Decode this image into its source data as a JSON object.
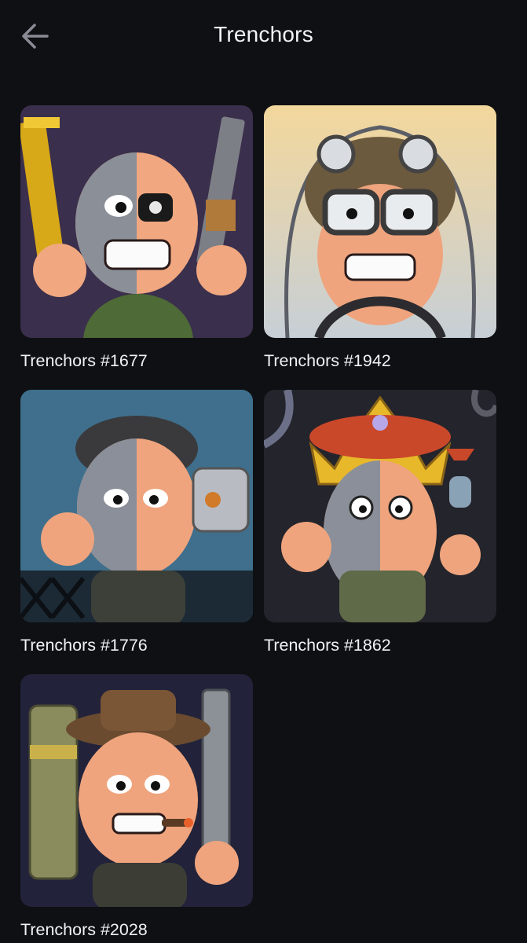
{
  "header": {
    "title": "Trenchors",
    "back_icon": "arrow-left-icon"
  },
  "colors": {
    "background": "#0f1013",
    "text": "#f2f2f4",
    "back_icon": "#8a8c95"
  },
  "items": [
    {
      "label": "Trenchors #1677",
      "bg": "#3a2f4c"
    },
    {
      "label": "Trenchors #1942",
      "bg": "#e9d9b0"
    },
    {
      "label": "Trenchors #1776",
      "bg": "#3f6f8c"
    },
    {
      "label": "Trenchors #1862",
      "bg": "#24242c"
    },
    {
      "label": "Trenchors #2028",
      "bg": "#22233a"
    }
  ]
}
